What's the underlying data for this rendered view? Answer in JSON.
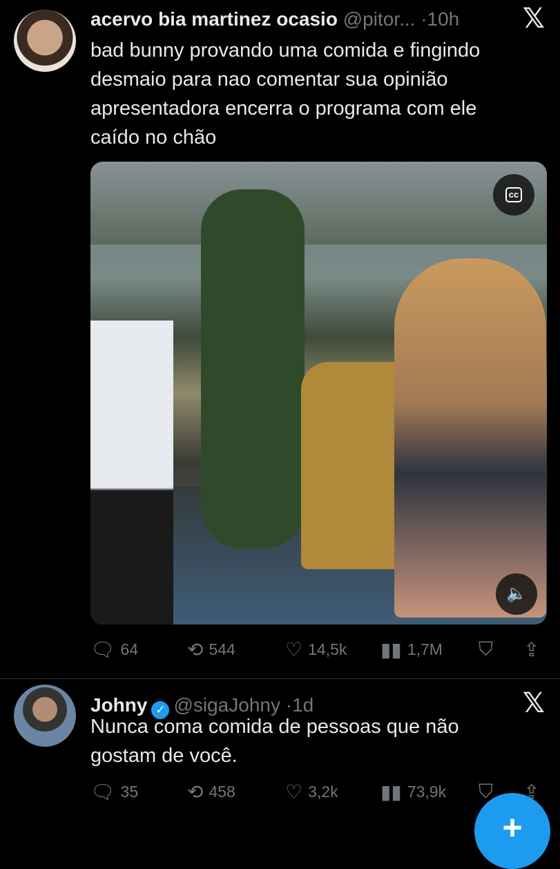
{
  "tweets": [
    {
      "author": "acervo bia martinez ocasio",
      "handle": "@pitor...",
      "dot": "·",
      "time": "10h",
      "text": "bad bunny provando uma comida e fingindo\ndesmaio para nao comentar sua opinião\napresentadora encerra o programa com ele\ncaído no chão",
      "media_cc": "cc",
      "stats": {
        "replies": "64",
        "retweets": "544",
        "likes": "14,5k",
        "views": "1,7M"
      }
    },
    {
      "author": "Johny",
      "verified": true,
      "handle": "@sigaJohny",
      "dot": "·",
      "time": "1d",
      "text": "Nunca coma comida de pessoas que não\ngostam de você.",
      "stats": {
        "replies": "35",
        "retweets": "458",
        "likes": "3,2k",
        "views": "73,9k"
      }
    }
  ],
  "icons": {
    "x_logo": "𝕏",
    "reply": "reply-icon",
    "retweet": "retweet-icon",
    "like": "heart-icon",
    "views": "views-icon",
    "bookmark": "bookmark-icon",
    "share": "share-icon",
    "compose": "+"
  },
  "colors": {
    "accent": "#1d9bf0",
    "muted": "#71767b",
    "text": "#e7e9ea",
    "background": "#000000"
  }
}
